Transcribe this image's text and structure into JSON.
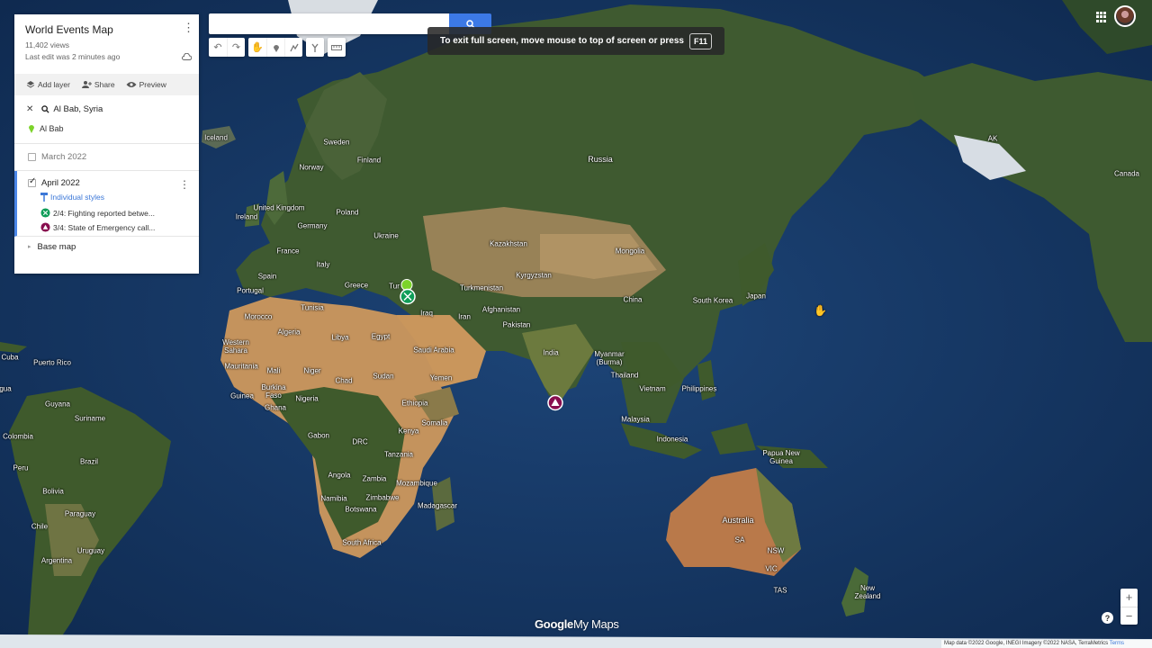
{
  "map": {
    "labels": {
      "iceland": "Iceland",
      "sweden": "Sweden",
      "finland": "Finland",
      "norway": "Norway",
      "russia": "Russia",
      "united_kingdom": "United Kingdom",
      "ireland": "Ireland",
      "poland": "Poland",
      "germany": "Germany",
      "ukraine": "Ukraine",
      "france": "France",
      "spain": "Spain",
      "portugal": "Portugal",
      "italy": "Italy",
      "greece": "Greece",
      "turkey_partial": "Tur",
      "kazakhstan": "Kazakhstan",
      "mongolia": "Mongolia",
      "kyrgyzstan": "Kyrgyzstan",
      "turkmenistan": "Turkmenistan",
      "afghanistan": "Afghanistan",
      "iran": "Iran",
      "iraq": "Iraq",
      "pakistan": "Pakistan",
      "china": "China",
      "south_korea": "South Korea",
      "japan": "Japan",
      "india": "India",
      "myanmar": "Myanmar\n(Burma)",
      "thailand": "Thailand",
      "vietnam": "Vietnam",
      "philippines": "Philippines",
      "malaysia": "Malaysia",
      "indonesia": "Indonesia",
      "papua_new_guinea": "Papua New\nGuinea",
      "australia": "Australia",
      "new_zealand": "New\nZealand",
      "morocco": "Morocco",
      "algeria": "Algeria",
      "tunisia": "Tunisia",
      "libya": "Libya",
      "egypt": "Egypt",
      "saudi_arabia": "Saudi Arabia",
      "yemen": "Yemen",
      "western_sahara": "Western\nSahara",
      "mauritania": "Mauritania",
      "mali": "Mali",
      "niger": "Niger",
      "chad": "Chad",
      "sudan": "Sudan",
      "ethiopia": "Ethiopia",
      "somalia": "Somalia",
      "guinea": "Guinea",
      "burkina_faso": "Burkina\nFaso",
      "ghana": "Ghana",
      "nigeria": "Nigeria",
      "gabon": "Gabon",
      "drc": "DRC",
      "kenya": "Kenya",
      "tanzania": "Tanzania",
      "angola": "Angola",
      "zambia": "Zambia",
      "zimbabwe": "Zimbabwe",
      "mozambique": "Mozambique",
      "namibia": "Namibia",
      "botswana": "Botswana",
      "madagascar": "Madagascar",
      "south_africa": "South Africa",
      "cuba": "Cuba",
      "puerto_rico": "Puerto Rico",
      "guyana": "Guyana",
      "suriname": "Suriname",
      "colombia": "Colombia",
      "peru": "Peru",
      "brazil": "Brazil",
      "bolivia": "Bolivia",
      "paraguay": "Paraguay",
      "chile": "Chile",
      "uruguay": "Uruguay",
      "argentina": "Argentina",
      "canada": "Canada",
      "gua_partial": "gua",
      "ak": "AK",
      "sa": "SA",
      "nsw": "NSW",
      "vic": "VIC",
      "tas": "TAS"
    }
  },
  "toast": {
    "text": "To exit full screen, move mouse to top of screen or press",
    "key": "F11"
  },
  "panel": {
    "title": "World Events Map",
    "views": "11,402 views",
    "last_edit": "Last edit was 2 minutes ago",
    "actions": {
      "add_layer": "Add layer",
      "share": "Share",
      "preview": "Preview"
    },
    "search_query": "Al Bab, Syria",
    "search_result": "Al Bab",
    "layers": {
      "march": "March 2022",
      "april": "April 2022",
      "individual_styles": "Individual styles",
      "items": [
        {
          "label": "2/4: Fighting reported betwe...",
          "color": "#0f9d58"
        },
        {
          "label": "3/4: State of Emergency call...",
          "color": "#880e4f"
        }
      ]
    },
    "base_map": "Base map"
  },
  "controls": {
    "zoom_in": "+",
    "zoom_out": "−",
    "help": "?"
  },
  "branding": {
    "logo_google": "Google",
    "logo_mymaps": "My Maps"
  },
  "attribution": {
    "text": "Map data ©2022 Google, INEGI Imagery ©2022 NASA, TerraMetrics",
    "terms": "Terms"
  },
  "colors": {
    "ocean": "#1b3f6e",
    "land_green": "#3d5a2c",
    "desert": "#c79a6a",
    "accent_blue": "#4a86e8",
    "marker_green": "#0f9d58",
    "marker_purple": "#880e4f",
    "pin_green": "#7cd32a"
  }
}
